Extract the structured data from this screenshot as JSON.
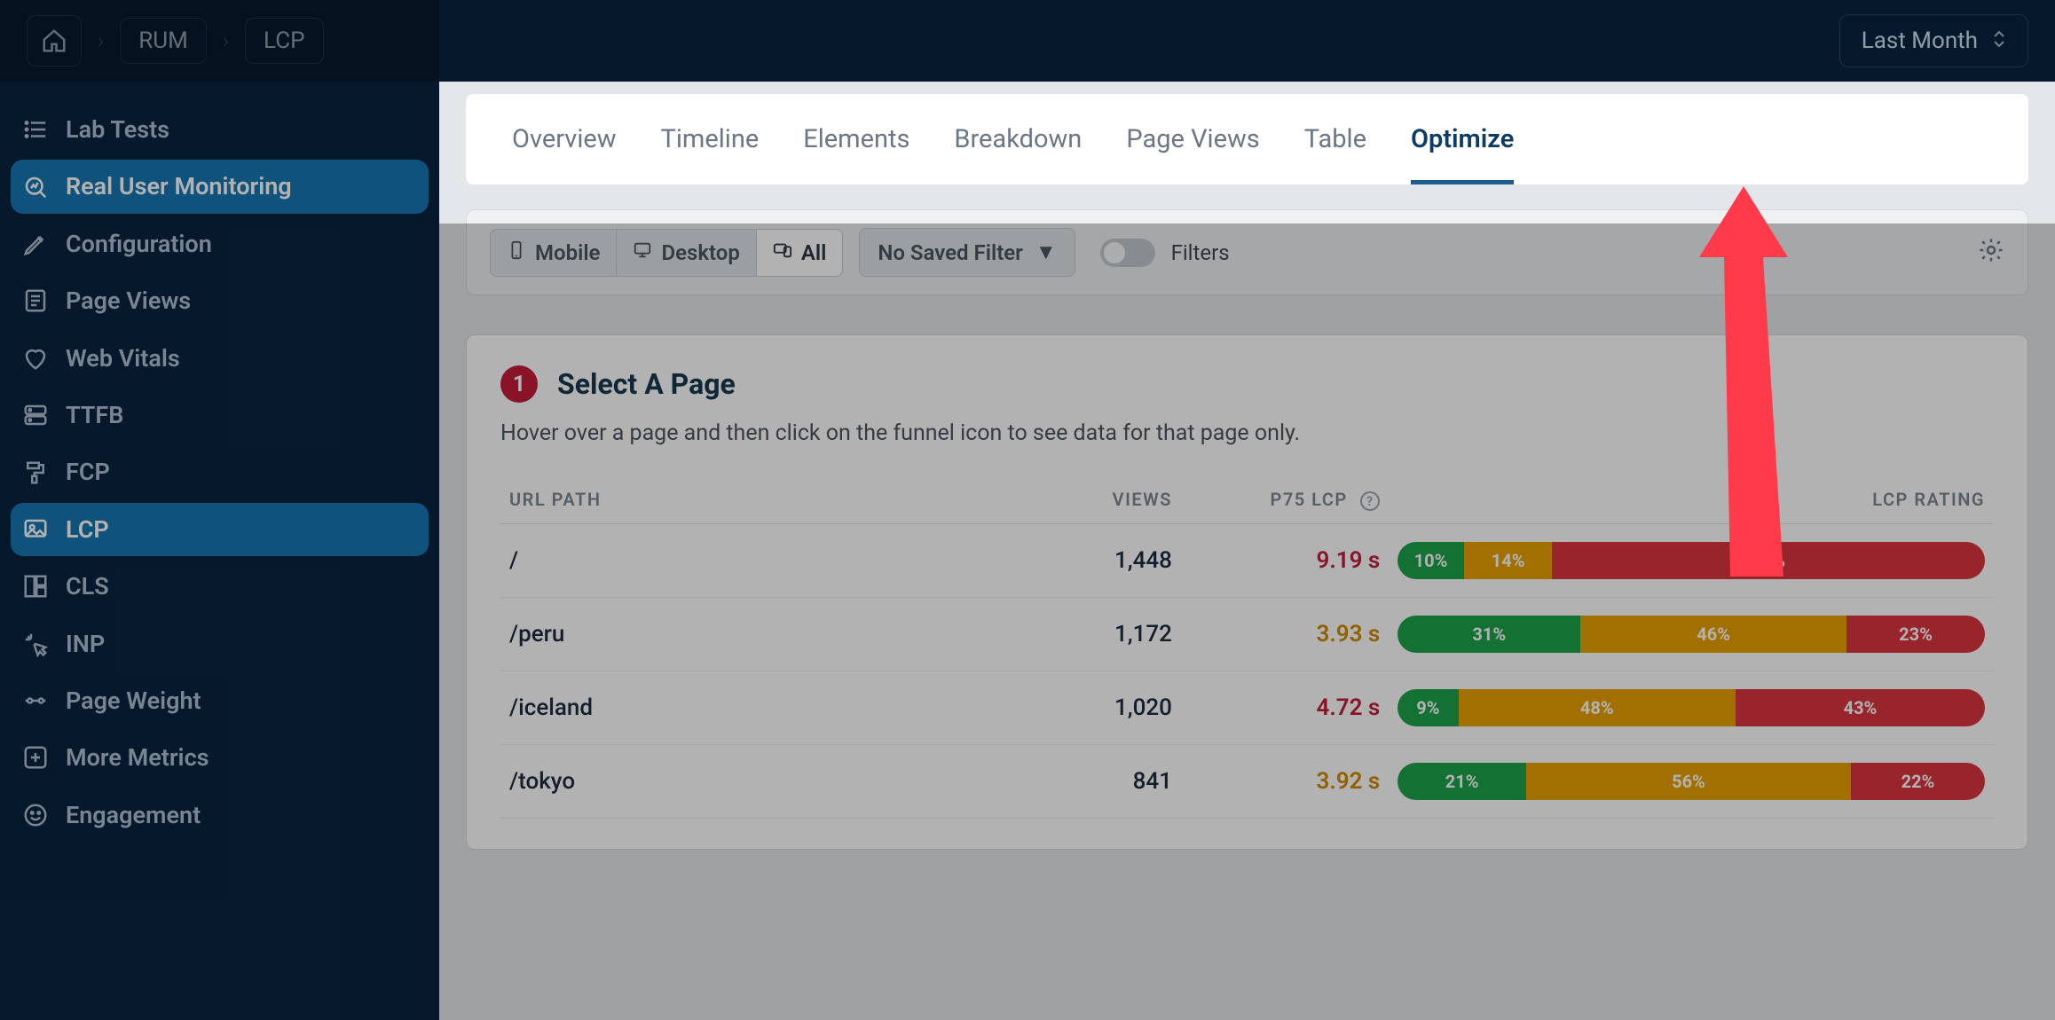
{
  "breadcrumbs": {
    "home": "home",
    "rum": "RUM",
    "lcp": "LCP"
  },
  "date_range": {
    "label": "Last Month"
  },
  "sidebar": {
    "items": [
      {
        "label": "Lab Tests",
        "icon": "list-icon"
      },
      {
        "label": "Real User Monitoring",
        "icon": "analytics-icon",
        "primary": true
      },
      {
        "label": "Configuration",
        "icon": "pencil-icon"
      },
      {
        "label": "Page Views",
        "icon": "page-icon"
      },
      {
        "label": "Web Vitals",
        "icon": "heart-icon"
      },
      {
        "label": "TTFB",
        "icon": "server-icon"
      },
      {
        "label": "FCP",
        "icon": "paint-icon"
      },
      {
        "label": "LCP",
        "icon": "image-icon",
        "active": true
      },
      {
        "label": "CLS",
        "icon": "layout-icon"
      },
      {
        "label": "INP",
        "icon": "click-icon"
      },
      {
        "label": "Page Weight",
        "icon": "weight-icon"
      },
      {
        "label": "More Metrics",
        "icon": "plus-icon"
      },
      {
        "label": "Engagement",
        "icon": "engage-icon"
      }
    ]
  },
  "tabs": [
    {
      "label": "Overview"
    },
    {
      "label": "Timeline"
    },
    {
      "label": "Elements"
    },
    {
      "label": "Breakdown"
    },
    {
      "label": "Page Views"
    },
    {
      "label": "Table"
    },
    {
      "label": "Optimize",
      "active": true
    }
  ],
  "filterbar": {
    "devices": [
      {
        "label": "Mobile",
        "icon": "mobile-icon"
      },
      {
        "label": "Desktop",
        "icon": "desktop-icon"
      },
      {
        "label": "All",
        "icon": "devices-icon",
        "active": true
      }
    ],
    "saved_filter_label": "No Saved Filter",
    "filters_label": "Filters"
  },
  "page_select": {
    "step": "1",
    "title": "Select A Page",
    "subtitle": "Hover over a page and then click on the funnel icon to see data for that page only.",
    "columns": {
      "url": "URL PATH",
      "views": "VIEWS",
      "p75": "P75 LCP",
      "rating": "LCP RATING"
    },
    "rows": [
      {
        "url": "/",
        "views": "1,448",
        "p75": "9.19 s",
        "p75_class": "poor",
        "rating": {
          "good": 10,
          "ni": 14,
          "poor": 76
        }
      },
      {
        "url": "/peru",
        "views": "1,172",
        "p75": "3.93 s",
        "p75_class": "ni",
        "rating": {
          "good": 31,
          "ni": 46,
          "poor": 23
        }
      },
      {
        "url": "/iceland",
        "views": "1,020",
        "p75": "4.72 s",
        "p75_class": "poor",
        "rating": {
          "good": 9,
          "ni": 48,
          "poor": 43
        }
      },
      {
        "url": "/tokyo",
        "views": "841",
        "p75": "3.92 s",
        "p75_class": "ni",
        "rating": {
          "good": 21,
          "ni": 56,
          "poor": 22
        }
      }
    ]
  }
}
